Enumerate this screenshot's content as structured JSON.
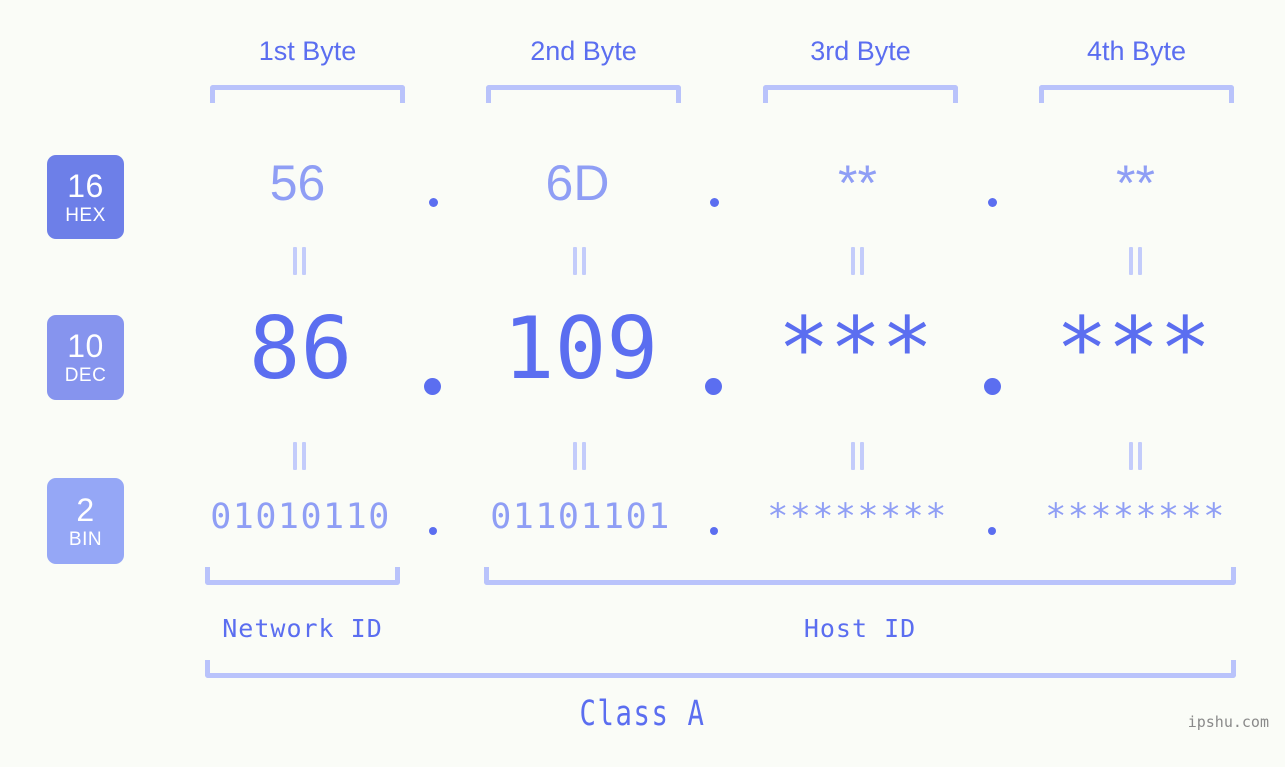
{
  "page": {
    "background_color": "#fafcf7",
    "accent_strong": "#5b6ef0",
    "accent_light": "#8f9ef5",
    "bracket_color": "#b9c3fb",
    "watermark": "ipshu.com"
  },
  "byte_headers": [
    {
      "label": "1st Byte"
    },
    {
      "label": "2nd Byte"
    },
    {
      "label": "3rd Byte"
    },
    {
      "label": "4th Byte"
    }
  ],
  "bases": [
    {
      "num": "16",
      "abbr": "HEX",
      "color": "#6d7fe8"
    },
    {
      "num": "10",
      "abbr": "DEC",
      "color": "#8694ee"
    },
    {
      "num": "2",
      "abbr": "BIN",
      "color": "#95a7f6"
    }
  ],
  "rows": {
    "hex": {
      "values": [
        "56",
        "6D",
        "**",
        "**"
      ]
    },
    "dec": {
      "values": [
        "86",
        "109",
        "***",
        "***"
      ]
    },
    "bin": {
      "values": [
        "01010110",
        "01101101",
        "********",
        "********"
      ]
    }
  },
  "separator": ".",
  "segments": {
    "network_id": "Network ID",
    "host_id": "Host ID"
  },
  "class": "Class A"
}
